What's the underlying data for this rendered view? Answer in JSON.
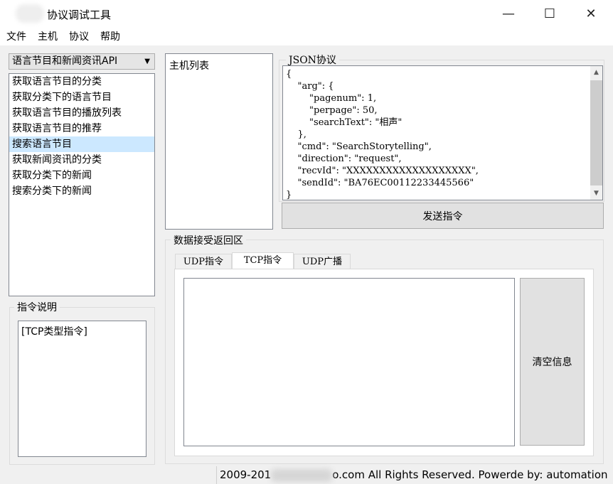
{
  "window": {
    "title": "协议调试工具",
    "controls": {
      "minimize": "—",
      "maximize": "☐",
      "close": "✕"
    }
  },
  "menu": [
    "文件",
    "主机",
    "协议",
    "帮助"
  ],
  "api_combo": {
    "selected": "语言节目和新闻资讯API"
  },
  "command_list": {
    "items": [
      "获取语言节目的分类",
      "获取分类下的语言节目",
      "获取语言节目的播放列表",
      "获取语言节目的推荐",
      "搜索语言节目",
      "获取新闻资讯的分类",
      "获取分类下的新闻",
      "搜索分类下的新闻"
    ],
    "selected_index": 4
  },
  "instruction_desc": {
    "label": "指令说明",
    "text": "[TCP类型指令]"
  },
  "host_list": {
    "label": "主机列表"
  },
  "json_protocol": {
    "label": "JSON协议",
    "lines": [
      "{",
      "    \"arg\": {",
      "        \"pagenum\": 1,",
      "        \"perpage\": 50,",
      "        \"searchText\": \"相声\"",
      "    },",
      "    \"cmd\": \"SearchStorytelling\",",
      "    \"direction\": \"request\",",
      "    \"recvId\": \"XXXXXXXXXXXXXXXXXXX\",",
      "    \"sendId\": \"BA76EC00112233445566\"",
      "}"
    ]
  },
  "send_button": "发送指令",
  "receive_area": {
    "label": "数据接受返回区",
    "tabs": [
      "UDP指令",
      "TCP指令",
      "UDP广播"
    ],
    "active_tab": 1,
    "clear_button": "清空信息"
  },
  "footer": {
    "left": "2009-201",
    "right": "o.com All Rights Reserved. Powerde by:  automation"
  }
}
